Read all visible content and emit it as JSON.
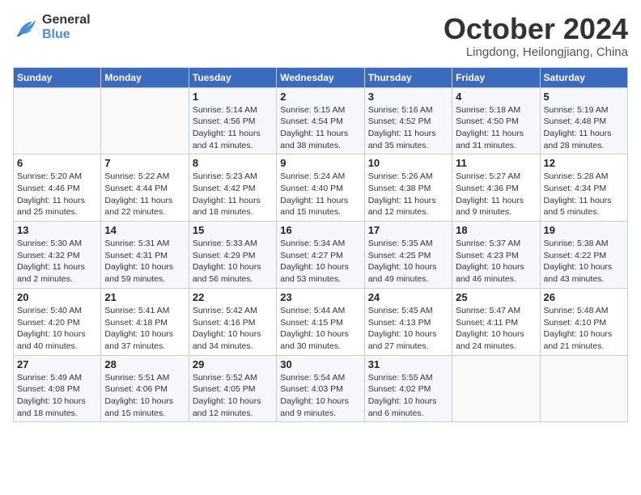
{
  "header": {
    "logo": {
      "line1": "General",
      "line2": "Blue"
    },
    "title": "October 2024",
    "subtitle": "Lingdong, Heilongjiang, China"
  },
  "weekdays": [
    "Sunday",
    "Monday",
    "Tuesday",
    "Wednesday",
    "Thursday",
    "Friday",
    "Saturday"
  ],
  "weeks": [
    [
      {
        "day": "",
        "sunrise": "",
        "sunset": "",
        "daylight": ""
      },
      {
        "day": "",
        "sunrise": "",
        "sunset": "",
        "daylight": ""
      },
      {
        "day": "1",
        "sunrise": "Sunrise: 5:14 AM",
        "sunset": "Sunset: 4:56 PM",
        "daylight": "Daylight: 11 hours and 41 minutes."
      },
      {
        "day": "2",
        "sunrise": "Sunrise: 5:15 AM",
        "sunset": "Sunset: 4:54 PM",
        "daylight": "Daylight: 11 hours and 38 minutes."
      },
      {
        "day": "3",
        "sunrise": "Sunrise: 5:16 AM",
        "sunset": "Sunset: 4:52 PM",
        "daylight": "Daylight: 11 hours and 35 minutes."
      },
      {
        "day": "4",
        "sunrise": "Sunrise: 5:18 AM",
        "sunset": "Sunset: 4:50 PM",
        "daylight": "Daylight: 11 hours and 31 minutes."
      },
      {
        "day": "5",
        "sunrise": "Sunrise: 5:19 AM",
        "sunset": "Sunset: 4:48 PM",
        "daylight": "Daylight: 11 hours and 28 minutes."
      }
    ],
    [
      {
        "day": "6",
        "sunrise": "Sunrise: 5:20 AM",
        "sunset": "Sunset: 4:46 PM",
        "daylight": "Daylight: 11 hours and 25 minutes."
      },
      {
        "day": "7",
        "sunrise": "Sunrise: 5:22 AM",
        "sunset": "Sunset: 4:44 PM",
        "daylight": "Daylight: 11 hours and 22 minutes."
      },
      {
        "day": "8",
        "sunrise": "Sunrise: 5:23 AM",
        "sunset": "Sunset: 4:42 PM",
        "daylight": "Daylight: 11 hours and 18 minutes."
      },
      {
        "day": "9",
        "sunrise": "Sunrise: 5:24 AM",
        "sunset": "Sunset: 4:40 PM",
        "daylight": "Daylight: 11 hours and 15 minutes."
      },
      {
        "day": "10",
        "sunrise": "Sunrise: 5:26 AM",
        "sunset": "Sunset: 4:38 PM",
        "daylight": "Daylight: 11 hours and 12 minutes."
      },
      {
        "day": "11",
        "sunrise": "Sunrise: 5:27 AM",
        "sunset": "Sunset: 4:36 PM",
        "daylight": "Daylight: 11 hours and 9 minutes."
      },
      {
        "day": "12",
        "sunrise": "Sunrise: 5:28 AM",
        "sunset": "Sunset: 4:34 PM",
        "daylight": "Daylight: 11 hours and 5 minutes."
      }
    ],
    [
      {
        "day": "13",
        "sunrise": "Sunrise: 5:30 AM",
        "sunset": "Sunset: 4:32 PM",
        "daylight": "Daylight: 11 hours and 2 minutes."
      },
      {
        "day": "14",
        "sunrise": "Sunrise: 5:31 AM",
        "sunset": "Sunset: 4:31 PM",
        "daylight": "Daylight: 10 hours and 59 minutes."
      },
      {
        "day": "15",
        "sunrise": "Sunrise: 5:33 AM",
        "sunset": "Sunset: 4:29 PM",
        "daylight": "Daylight: 10 hours and 56 minutes."
      },
      {
        "day": "16",
        "sunrise": "Sunrise: 5:34 AM",
        "sunset": "Sunset: 4:27 PM",
        "daylight": "Daylight: 10 hours and 53 minutes."
      },
      {
        "day": "17",
        "sunrise": "Sunrise: 5:35 AM",
        "sunset": "Sunset: 4:25 PM",
        "daylight": "Daylight: 10 hours and 49 minutes."
      },
      {
        "day": "18",
        "sunrise": "Sunrise: 5:37 AM",
        "sunset": "Sunset: 4:23 PM",
        "daylight": "Daylight: 10 hours and 46 minutes."
      },
      {
        "day": "19",
        "sunrise": "Sunrise: 5:38 AM",
        "sunset": "Sunset: 4:22 PM",
        "daylight": "Daylight: 10 hours and 43 minutes."
      }
    ],
    [
      {
        "day": "20",
        "sunrise": "Sunrise: 5:40 AM",
        "sunset": "Sunset: 4:20 PM",
        "daylight": "Daylight: 10 hours and 40 minutes."
      },
      {
        "day": "21",
        "sunrise": "Sunrise: 5:41 AM",
        "sunset": "Sunset: 4:18 PM",
        "daylight": "Daylight: 10 hours and 37 minutes."
      },
      {
        "day": "22",
        "sunrise": "Sunrise: 5:42 AM",
        "sunset": "Sunset: 4:16 PM",
        "daylight": "Daylight: 10 hours and 34 minutes."
      },
      {
        "day": "23",
        "sunrise": "Sunrise: 5:44 AM",
        "sunset": "Sunset: 4:15 PM",
        "daylight": "Daylight: 10 hours and 30 minutes."
      },
      {
        "day": "24",
        "sunrise": "Sunrise: 5:45 AM",
        "sunset": "Sunset: 4:13 PM",
        "daylight": "Daylight: 10 hours and 27 minutes."
      },
      {
        "day": "25",
        "sunrise": "Sunrise: 5:47 AM",
        "sunset": "Sunset: 4:11 PM",
        "daylight": "Daylight: 10 hours and 24 minutes."
      },
      {
        "day": "26",
        "sunrise": "Sunrise: 5:48 AM",
        "sunset": "Sunset: 4:10 PM",
        "daylight": "Daylight: 10 hours and 21 minutes."
      }
    ],
    [
      {
        "day": "27",
        "sunrise": "Sunrise: 5:49 AM",
        "sunset": "Sunset: 4:08 PM",
        "daylight": "Daylight: 10 hours and 18 minutes."
      },
      {
        "day": "28",
        "sunrise": "Sunrise: 5:51 AM",
        "sunset": "Sunset: 4:06 PM",
        "daylight": "Daylight: 10 hours and 15 minutes."
      },
      {
        "day": "29",
        "sunrise": "Sunrise: 5:52 AM",
        "sunset": "Sunset: 4:05 PM",
        "daylight": "Daylight: 10 hours and 12 minutes."
      },
      {
        "day": "30",
        "sunrise": "Sunrise: 5:54 AM",
        "sunset": "Sunset: 4:03 PM",
        "daylight": "Daylight: 10 hours and 9 minutes."
      },
      {
        "day": "31",
        "sunrise": "Sunrise: 5:55 AM",
        "sunset": "Sunset: 4:02 PM",
        "daylight": "Daylight: 10 hours and 6 minutes."
      },
      {
        "day": "",
        "sunrise": "",
        "sunset": "",
        "daylight": ""
      },
      {
        "day": "",
        "sunrise": "",
        "sunset": "",
        "daylight": ""
      }
    ]
  ]
}
